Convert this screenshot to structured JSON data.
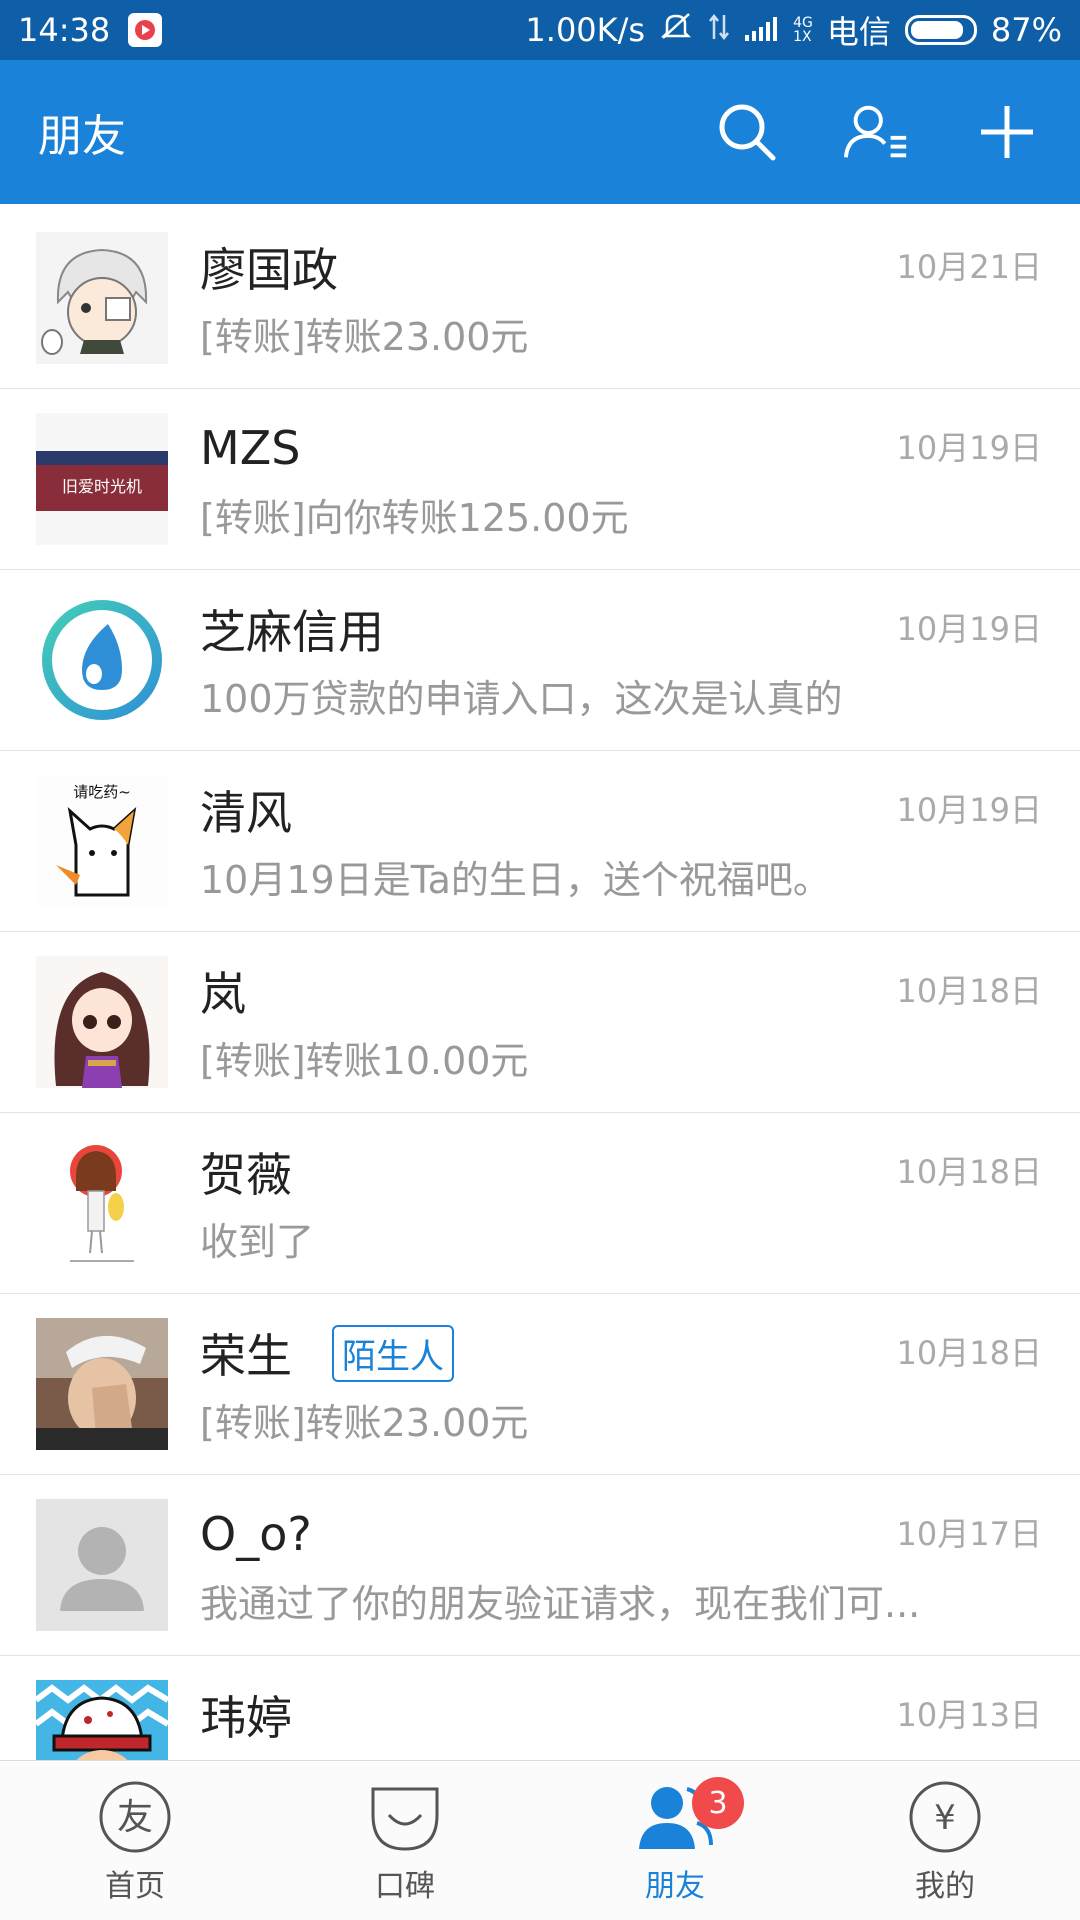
{
  "status_bar": {
    "time": "14:38",
    "speed": "1.00K/s",
    "net_top": "4G",
    "net_bottom": "1X",
    "carrier": "电信",
    "battery": "87%",
    "battery_level": 0.87
  },
  "header": {
    "title": "朋友",
    "icons": [
      "search-icon",
      "contacts-icon",
      "add-icon"
    ]
  },
  "conversations": [
    {
      "name": "廖国政",
      "message": "[转账]转账23.00元",
      "date": "10月21日",
      "tag": "",
      "avatar": "anime-boy"
    },
    {
      "name": "MZS",
      "message": "[转账]向你转账125.00元",
      "date": "10月19日",
      "tag": "",
      "avatar": "banner",
      "avatar_text": "旧爱时光机"
    },
    {
      "name": "芝麻信用",
      "message": "100万贷款的申请入口，这次是认真的",
      "date": "10月19日",
      "tag": "",
      "avatar": "zhima"
    },
    {
      "name": "清风",
      "message": "10月19日是Ta的生日，送个祝福吧。",
      "date": "10月19日",
      "tag": "",
      "avatar": "cat",
      "avatar_text": "请吃药~"
    },
    {
      "name": "岚",
      "message": "[转账]转账10.00元",
      "date": "10月18日",
      "tag": "",
      "avatar": "anime-girl"
    },
    {
      "name": "贺薇",
      "message": "收到了",
      "date": "10月18日",
      "tag": "",
      "avatar": "girl-sketch"
    },
    {
      "name": "荣生",
      "message": "[转账]转账23.00元",
      "date": "10月18日",
      "tag": "陌生人",
      "avatar": "photo"
    },
    {
      "name": "O_o?",
      "message": "我通过了你的朋友验证请求，现在我们可...",
      "date": "10月17日",
      "tag": "",
      "avatar": "default"
    },
    {
      "name": "玮婷",
      "message": "",
      "date": "10月13日",
      "tag": "",
      "avatar": "zigzag"
    }
  ],
  "tabs": [
    {
      "label": "首页",
      "icon": "you-icon",
      "active": false,
      "badge": ""
    },
    {
      "label": "口碑",
      "icon": "koubei-icon",
      "active": false,
      "badge": ""
    },
    {
      "label": "朋友",
      "icon": "friends-icon",
      "active": true,
      "badge": "3"
    },
    {
      "label": "我的",
      "icon": "yuan-icon",
      "active": false,
      "badge": ""
    }
  ],
  "colors": {
    "status_bar": "#0f5fa8",
    "header": "#1a82d8",
    "badge": "#f04a4a"
  }
}
